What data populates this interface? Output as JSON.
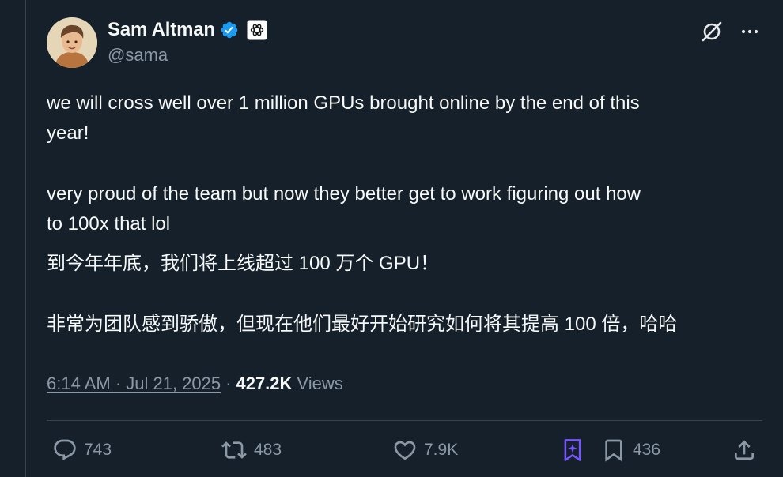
{
  "tweet": {
    "author": {
      "name": "Sam Altman",
      "handle": "@sama",
      "verified_color": "#1d9bf0"
    },
    "paragraphs": [
      "we will cross well over 1 million GPUs brought online by the end of this\nyear!",
      "very proud of the team but now they better get to work figuring out how\nto 100x that lol",
      "到今年年底，我们将上线超过 100 万个 GPU！",
      "非常为团队感到骄傲，但现在他们最好开始研究如何将其提高 100 倍，哈哈"
    ],
    "timestamp": "6:14 AM · Jul 21, 2025",
    "separator": "·",
    "views_count": "427.2K",
    "views_label": "Views"
  },
  "actions": {
    "replies": "743",
    "reposts": "483",
    "likes": "7.9K",
    "bookmarks": "436"
  },
  "colors": {
    "background": "#15202b",
    "text": "#f7f9f9",
    "secondary": "#8b98a5",
    "divider": "#38444d",
    "grok_accent": "#7856ff"
  }
}
